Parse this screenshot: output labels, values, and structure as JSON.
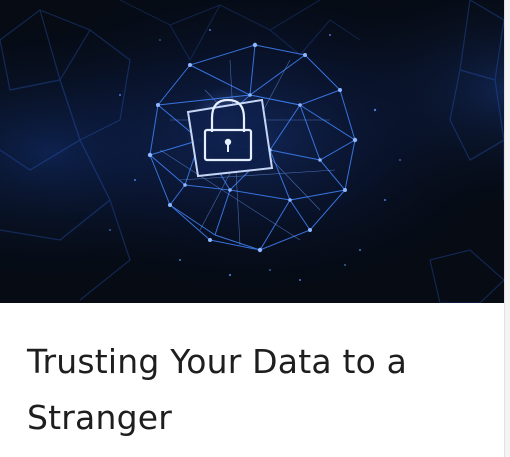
{
  "card": {
    "title": "Trusting Your Data to a Stranger",
    "image_icon": "padlock-icon"
  },
  "colors": {
    "hero_background": "#060b14",
    "network_blue": "#2f6fe0",
    "highlight": "#d8e6ff",
    "title_text": "#1e1e1e"
  }
}
